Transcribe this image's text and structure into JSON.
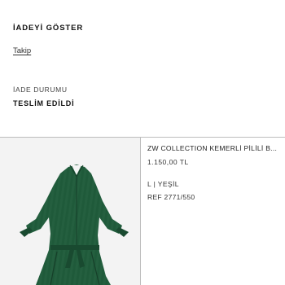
{
  "return": {
    "title": "İADEYİ GÖSTER",
    "track_label": "Takip",
    "status_label": "İADE DURUMU",
    "status_value": "TESLİM EDİLDİ"
  },
  "product": {
    "name": "ZW COLLECTION KEMERLİ PİLİLİ B...",
    "price": "1.150,00 TL",
    "variant": "L | YEŞİL",
    "ref": "REF 2771/550",
    "image_icon": "green-belted-dress-image",
    "dress_color": "#1f5a3a"
  }
}
